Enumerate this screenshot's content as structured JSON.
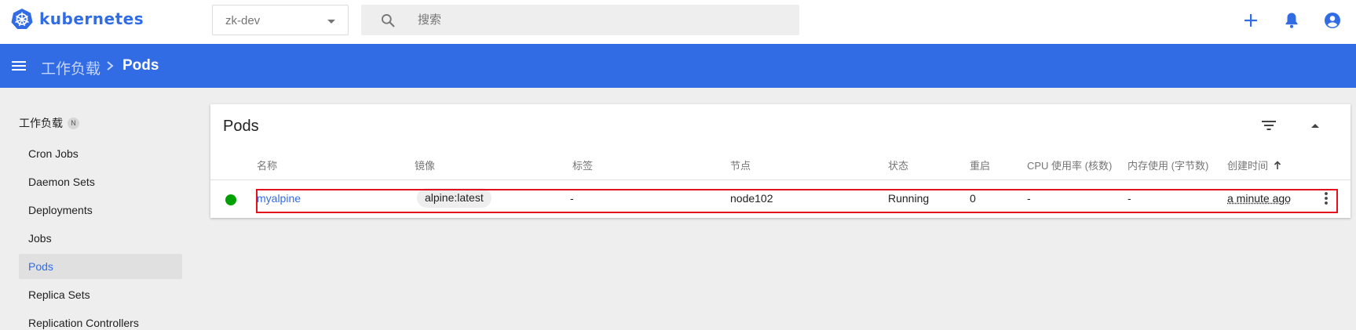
{
  "app": {
    "logo_text": "kubernetes"
  },
  "header": {
    "namespace": "zk-dev",
    "search_placeholder": "搜索"
  },
  "toolbar": {
    "breadcrumb_parent": "工作负载",
    "breadcrumb_current": "Pods"
  },
  "sidebar": {
    "section": "工作负载",
    "section_badge": "N",
    "items": [
      {
        "label": "Cron Jobs"
      },
      {
        "label": "Daemon Sets"
      },
      {
        "label": "Deployments"
      },
      {
        "label": "Jobs"
      },
      {
        "label": "Pods"
      },
      {
        "label": "Replica Sets"
      },
      {
        "label": "Replication Controllers"
      }
    ],
    "active": "Pods"
  },
  "card": {
    "title": "Pods",
    "columns": [
      "名称",
      "镜像",
      "标签",
      "节点",
      "状态",
      "重启",
      "CPU 使用率 (核数)",
      "内存使用 (字节数)",
      "创建时间"
    ],
    "rows": [
      {
        "status": "running",
        "status_color": "#00a000",
        "name": "myalpine",
        "image": "alpine:latest",
        "labels": "-",
        "node": "node102",
        "state": "Running",
        "restarts": "0",
        "cpu": "-",
        "memory": "-",
        "created": "a minute ago"
      }
    ]
  },
  "colors": {
    "brand": "#326ce5",
    "highlight": "#e5101d",
    "running": "#00a000"
  },
  "icons": [
    "kubernetes-logo",
    "search-icon",
    "add-icon",
    "bell-icon",
    "account-icon",
    "menu-icon",
    "chevron-right-icon",
    "filter-icon",
    "collapse-icon",
    "sort-arrow-up-icon",
    "more-vert-icon"
  ]
}
